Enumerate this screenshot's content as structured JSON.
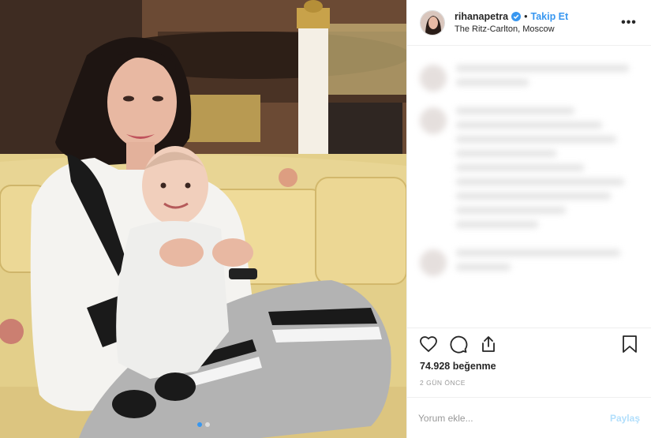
{
  "header": {
    "username": "rihanapetra",
    "separator": "•",
    "follow_label": "Takip Et",
    "location": "The Ritz-Carlton, Moscow",
    "more_label": "•••"
  },
  "photo": {
    "carousel_dots": 2,
    "active_dot": 0
  },
  "actions": {
    "like_icon": "heart-icon",
    "comment_icon": "comment-icon",
    "share_icon": "share-icon",
    "save_icon": "bookmark-icon"
  },
  "likes": "74.928 beğenme",
  "timestamp": "2 GÜN ÖNCE",
  "comment_input": {
    "placeholder": "Yorum ekle...",
    "post_label": "Paylaş"
  },
  "colors": {
    "accent": "#3897f0",
    "post_disabled": "#b2dffc",
    "text": "#262626",
    "muted": "#999999"
  }
}
